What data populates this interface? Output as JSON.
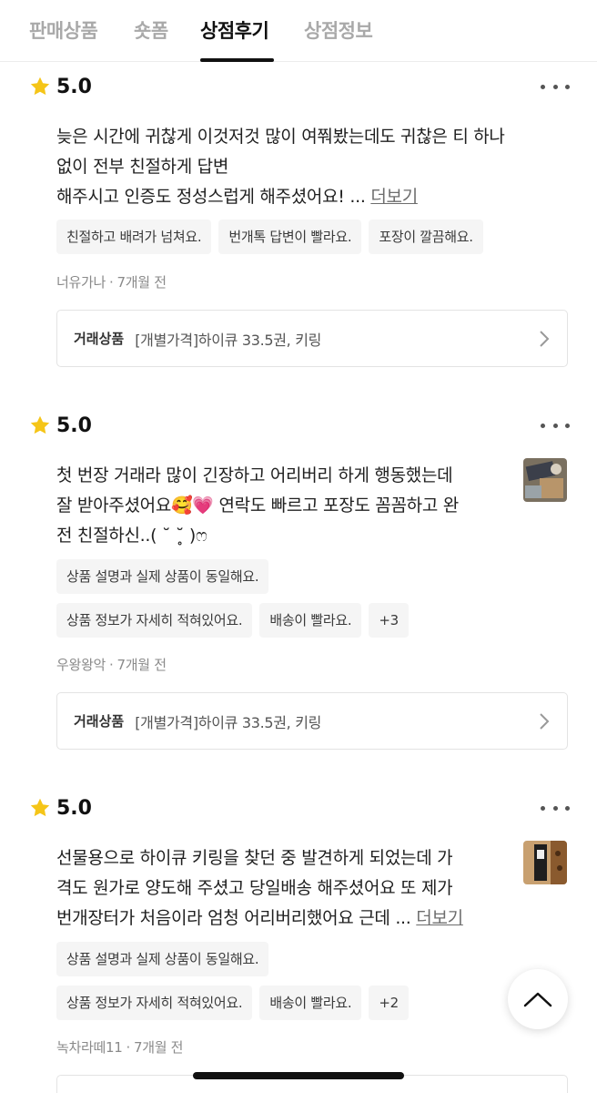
{
  "tabs": [
    {
      "label": "판매상품"
    },
    {
      "label": "숏폼"
    },
    {
      "label": "상점후기"
    },
    {
      "label": "상점정보"
    }
  ],
  "reviews": [
    {
      "rating": "5.0",
      "text_lines": [
        "늦은 시간에 귀찮게 이것저것 많이 여쭤봤는데도 귀찮은 티 하나",
        "없이 전부 친절하게 답변",
        "해주시고 인증도 정성스럽게 해주셨어요!"
      ],
      "ellipsis": "...",
      "read_more": "더보기",
      "tags": [
        "친절하고 배려가 넘쳐요.",
        "번개톡 답변이 빨라요.",
        "포장이 깔끔해요."
      ],
      "author": "너유가나",
      "time": "7개월 전",
      "product_label": "거래상품",
      "product_name": "[개별가격]하이큐 33.5권, 키링"
    },
    {
      "rating": "5.0",
      "text_lines": [
        "첫 번장 거래라 많이 긴장하고 어리버리 하게 행동했는데",
        "잘 받아주셨어요🥰💗 연락도 빠르고 포장도 꼼꼼하고 완",
        "전 친절하신..( ˘ ˘̥ )ෆ"
      ],
      "tags_row1": [
        "상품 설명과 실제 상품이 동일해요."
      ],
      "tags_row2": [
        "상품 정보가 자세히 적혀있어요.",
        "배송이 빨라요.",
        "+3"
      ],
      "author": "우왕왕악",
      "time": "7개월 전",
      "product_label": "거래상품",
      "product_name": "[개별가격]하이큐 33.5권, 키링"
    },
    {
      "rating": "5.0",
      "text_lines": [
        "선물용으로 하이큐 키링을 찾던 중 발견하게 되었는데 가",
        "격도 원가로 양도해 주셨고 당일배송 해주셨어요 또 제가",
        "번개장터가 처음이라 엄청 어리버리했어요 근데"
      ],
      "ellipsis": "...",
      "read_more": "더보기",
      "tags_row1": [
        "상품 설명과 실제 상품이 동일해요."
      ],
      "tags_row2": [
        "상품 정보가 자세히 적혀있어요.",
        "배송이 빨라요.",
        "+2"
      ],
      "author": "녹차라떼11",
      "time": "7개월 전"
    }
  ],
  "meta_separator": "·",
  "icons": {
    "star": "star-icon",
    "more": "more-dots-icon",
    "chevron": "chevron-right-icon",
    "scroll_top": "chevron-up-icon"
  },
  "colors": {
    "star": "#F5C518",
    "active_tab": "#111111",
    "inactive_tab": "#A9A9A9",
    "tag_bg": "#F5F5F5"
  }
}
